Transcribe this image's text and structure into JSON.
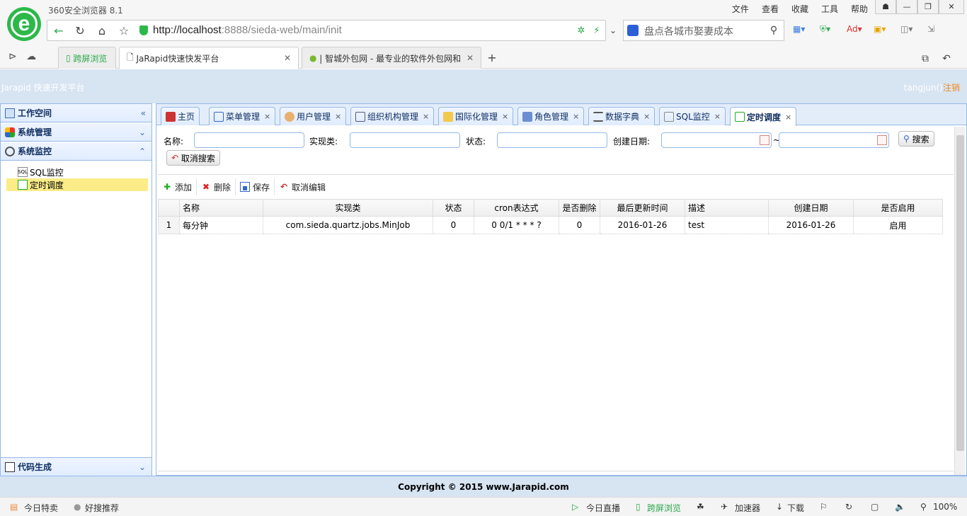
{
  "browser": {
    "brand": "360安全浏览器 8.1",
    "menu": [
      "文件",
      "查看",
      "收藏",
      "工具",
      "帮助"
    ],
    "window_buttons": [
      "☗",
      "—",
      "❐",
      "✕"
    ],
    "url_host": "http://localhost",
    "url_rest": ":8888/sieda-web/main/init",
    "search_placeholder": "盘点各城市娶妻成本",
    "tabs": [
      {
        "label": "跨屏浏览"
      },
      {
        "label": "JaRapid快速快发平台",
        "close": "✕"
      },
      {
        "label": "| 智城外包网 - 最专业的软件外包网和",
        "close": "✕"
      }
    ],
    "new_tab": "+"
  },
  "app": {
    "title": "Jarapid 快速开发平台",
    "user": "tangjun()",
    "logout": "注销"
  },
  "sidebar": {
    "workspace": "工作空间",
    "system_mgmt": "系统管理",
    "system_monitor": "系统监控",
    "code_gen": "代码生成",
    "collapse_icon": "«",
    "expand_icon": "»",
    "items": [
      {
        "label": "SQL监控",
        "icon": "SQL"
      },
      {
        "label": "定时调度"
      }
    ]
  },
  "tabs": [
    {
      "label": "主页"
    },
    {
      "label": "菜单管理",
      "close": "×"
    },
    {
      "label": "用户管理",
      "close": "×"
    },
    {
      "label": "组织机构管理",
      "close": "×"
    },
    {
      "label": "国际化管理",
      "close": "×"
    },
    {
      "label": "角色管理",
      "close": "×"
    },
    {
      "label": "数据字典",
      "close": "×"
    },
    {
      "label": "SQL监控",
      "close": "×"
    },
    {
      "label": "定时调度",
      "close": "×"
    }
  ],
  "form": {
    "name_label": "名称:",
    "impl_label": "实现类:",
    "status_label": "状态:",
    "created_label": "创建日期:",
    "tilde": "~",
    "search_btn": "搜索",
    "cancel_search_btn": "取消搜索"
  },
  "toolbar": {
    "add": "添加",
    "delete": "删除",
    "save": "保存",
    "cancel_edit": "取消编辑"
  },
  "grid": {
    "columns": [
      "名称",
      "实现类",
      "状态",
      "cron表达式",
      "是否删除",
      "最后更新时间",
      "描述",
      "创建日期",
      "是否启用"
    ],
    "rows": [
      [
        "1",
        "每分钟",
        "com.sieda.quartz.jobs.MinJob",
        "0",
        "0 0/1 * * * ?",
        "0",
        "2016-01-26",
        "test",
        "2016-01-26",
        "启用"
      ]
    ]
  },
  "footer": "Copyright © 2015 www.Jarapid.com",
  "statusbar": {
    "left1": "今日特卖",
    "left2": "好搜推荐",
    "r1": "今日直播",
    "r2": "跨屏浏览",
    "r3": "加速器",
    "r4": "下载",
    "zoom": "100%"
  }
}
